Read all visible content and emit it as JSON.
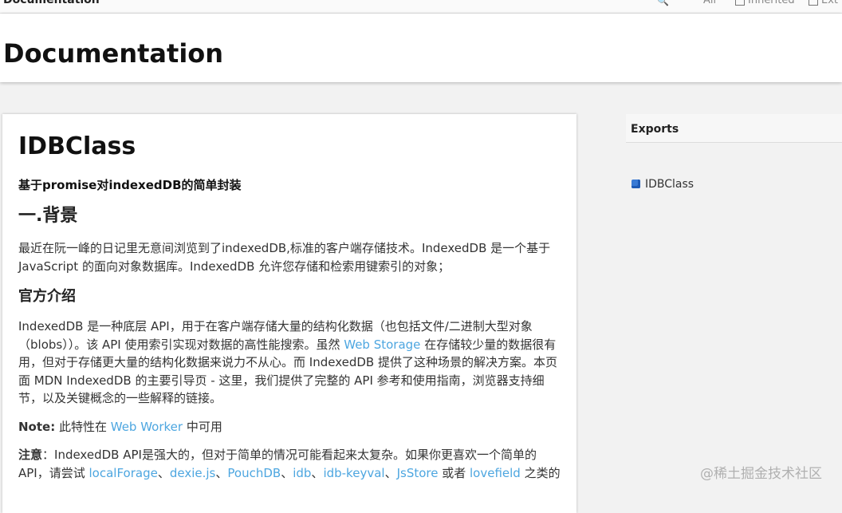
{
  "topbar": {
    "site_title": "Documentation",
    "filter_all": "All",
    "filter_inherited": "Inherited",
    "filter_external": "Ext"
  },
  "header": {
    "title": "Documentation"
  },
  "content": {
    "title": "IDBClass",
    "description": "基于promise对indexedDB的简单封装",
    "section_heading": "一.背景",
    "paragraph1": "最近在阮一峰的日记里无意间浏览到了indexedDB,标准的客户端存储技术。IndexedDB 是一个基于 JavaScript 的面向对象数据库。IndexedDB 允许您存储和检索用键索引的对象；",
    "subheading": "官方介绍",
    "paragraph2_part1": "IndexedDB 是一种底层 API，用于在客户端存储大量的结构化数据（也包括文件/二进制大型对象（blobs））。该 API 使用索引实现对数据的高性能搜索。虽然 ",
    "paragraph2_link": "Web Storage",
    "paragraph2_part2": " 在存储较少量的数据很有用，但对于存储更大量的结构化数据来说力不从心。而 IndexedDB 提供了这种场景的解决方案。本页面 MDN IndexedDB 的主要引导页 - 这里，我们提供了完整的 API 参考和使用指南，浏览器支持细节，以及关键概念的一些解释的链接。",
    "note_label": "Note:",
    "note_text1": " 此特性在 ",
    "note_link": "Web Worker",
    "note_text2": " 中可用",
    "caution_label": "注意",
    "caution_text1": "：IndexedDB API是强大的，但对于简单的情况可能看起来太复杂。如果你更喜欢一个简单的API，请尝试 ",
    "libs": [
      "localForage",
      "dexie.js",
      "PouchDB",
      "idb",
      "idb-keyval",
      "JsStore"
    ],
    "sep": "、",
    "or_text": " 或者 ",
    "last_lib": "lovefield",
    "caution_tail": " 之类的"
  },
  "sidebar": {
    "heading": "Exports",
    "items": [
      {
        "label": "IDBClass"
      }
    ]
  },
  "watermark": "@稀土掘金技术社区"
}
